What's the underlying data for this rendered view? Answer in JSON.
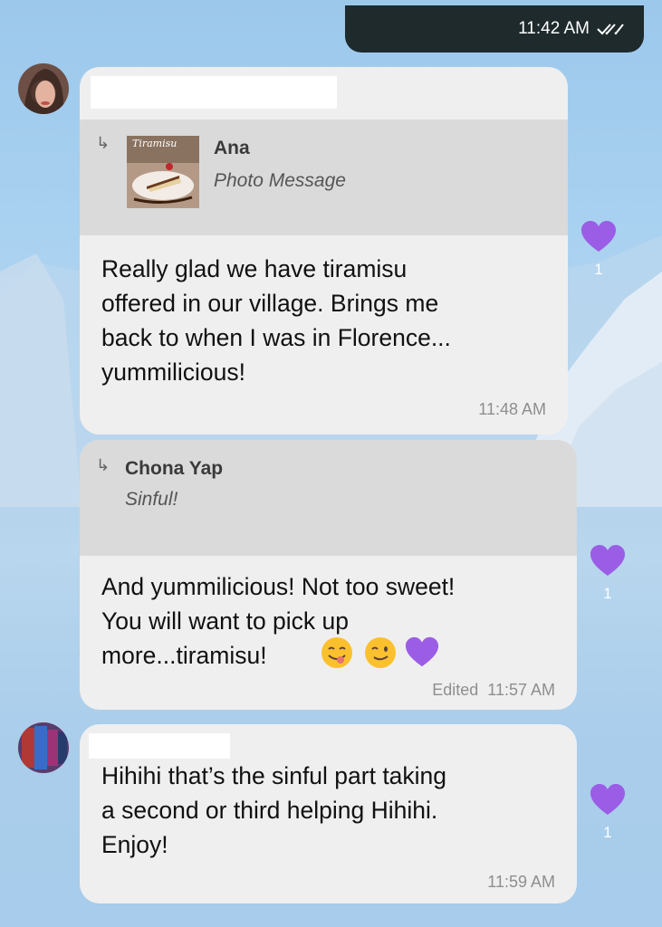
{
  "sent_message": {
    "time": "11:42 AM",
    "status_icon": "double-check-icon"
  },
  "messages": [
    {
      "quote": {
        "author": "Ana",
        "text": "Photo Message",
        "thumbnail_label": "Tiramisu"
      },
      "text": "Really glad we have tiramisu\noffered in our village. Brings me\nback to when I was in Florence...\nyummilicious!",
      "time": "11:48 AM",
      "reaction": {
        "icon": "purple-heart-icon",
        "count": "1"
      }
    },
    {
      "quote": {
        "author": "Chona Yap",
        "text": "Sinful!"
      },
      "text": "And yummilicious! Not too sweet!\nYou will want to pick up\nmore...tiramisu!",
      "emojis": [
        "face-savoring-food",
        "winking-face",
        "purple-heart"
      ],
      "time": "Edited  11:57 AM",
      "reaction": {
        "icon": "purple-heart-icon",
        "count": "1"
      }
    },
    {
      "text": "Hihihi that’s the sinful part taking\na second or third helping Hihihi.\nEnjoy!",
      "time": "11:59 AM",
      "reaction": {
        "icon": "purple-heart-icon",
        "count": "1"
      }
    }
  ],
  "colors": {
    "reaction": "#9b5de5",
    "bubble": "#efefef",
    "quote_bg": "#dadada",
    "sent_bubble": "#1e2a2c"
  }
}
